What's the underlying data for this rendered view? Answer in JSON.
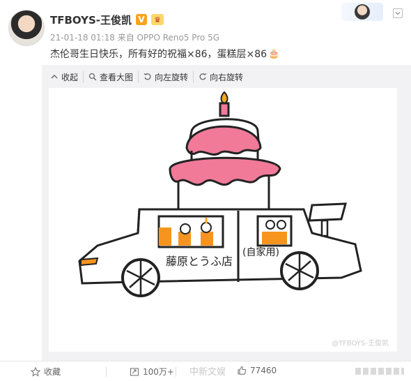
{
  "post": {
    "username": "TFBOYS-王俊凯",
    "verified_badge": "V",
    "timestamp": "21-01-18 01:18",
    "source_prefix": "来自",
    "source_device": "OPPO Reno5 Pro 5G",
    "text": "杰伦哥生日快乐，所有好的祝福×86，蛋糕层×86",
    "text_emoji": "cake-emoji"
  },
  "toolbar": {
    "collapse": "收起",
    "view_large": "查看大图",
    "rotate_left": "向左旋转",
    "rotate_right": "向右旋转"
  },
  "image": {
    "drawing_text": "藤原とうふ店",
    "drawing_text_sub": "(自家用)",
    "watermark": "@TFBOYS-王俊凯"
  },
  "footer": {
    "favorite": "收藏",
    "reposts": "100万+",
    "likes": "77460",
    "overlay_watermark": "中新文娱"
  },
  "colors": {
    "badge": "#f7a31f",
    "cake_pink": "#f07a98",
    "flame": "#f5a623",
    "window_orange": "#f7941d"
  }
}
